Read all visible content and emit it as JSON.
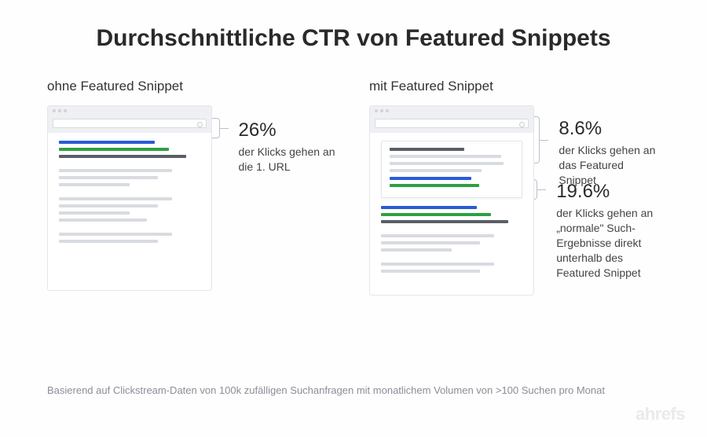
{
  "title": "Durchschnittliche CTR von Featured Snippets",
  "left": {
    "heading": "ohne Featured  Snippet",
    "callout_pct": "26%",
    "callout_text": "der Klicks  gehen an die 1. URL"
  },
  "right": {
    "heading": "mit Featured  Snippet",
    "callout1_pct": "8.6%",
    "callout1_text": "der Klicks gehen an das Featured Snippet",
    "callout2_pct": "19.6%",
    "callout2_text": "der Klicks gehen an „normale\" Such-Ergebnisse direkt unterhalb des Featured Snippet"
  },
  "footer": "Basierend auf Clickstream-Daten von 100k zufälligen Suchanfragen mit monatlichem Volumen von >100 Suchen pro Monat",
  "brand": "ahrefs",
  "chart_data": {
    "type": "table",
    "title": "Durchschnittliche CTR von Featured Snippets",
    "series": [
      {
        "name": "ohne Featured Snippet – 1. URL",
        "value": 26.0,
        "unit": "%"
      },
      {
        "name": "mit Featured Snippet – Featured Snippet",
        "value": 8.6,
        "unit": "%"
      },
      {
        "name": "mit Featured Snippet – normales Ergebnis darunter",
        "value": 19.6,
        "unit": "%"
      }
    ],
    "source": "Clickstream-Daten von 100k zufälligen Suchanfragen, monatl. Volumen >100"
  }
}
